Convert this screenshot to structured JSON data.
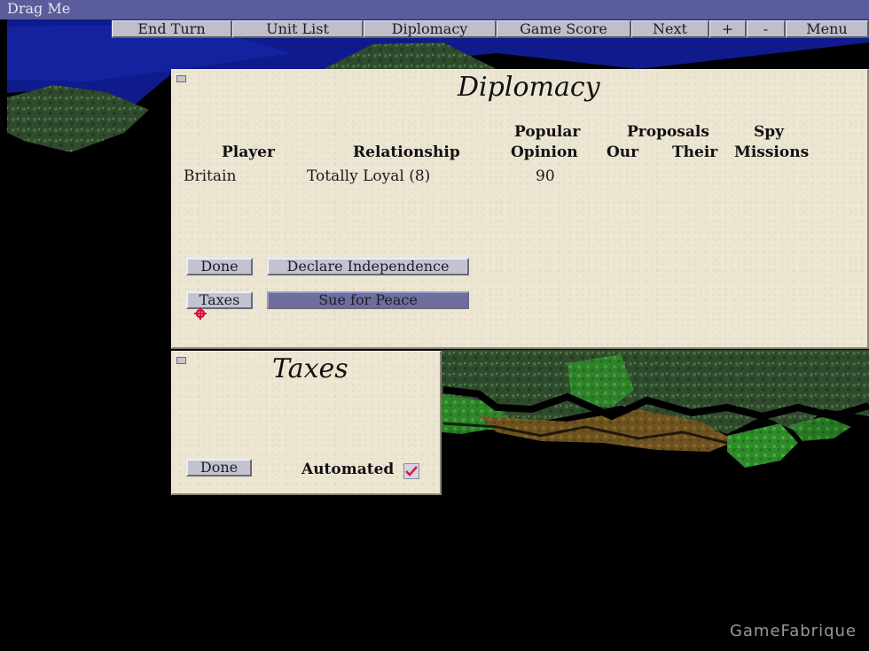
{
  "window": {
    "title": "Drag Me"
  },
  "menu": [
    {
      "id": "end-turn",
      "label": "End Turn"
    },
    {
      "id": "unit-list",
      "label": "Unit List"
    },
    {
      "id": "diplomacy",
      "label": "Diplomacy"
    },
    {
      "id": "game-score",
      "label": "Game Score"
    },
    {
      "id": "next",
      "label": "Next"
    },
    {
      "id": "plus",
      "label": "+"
    },
    {
      "id": "minus",
      "label": "-"
    },
    {
      "id": "menu",
      "label": "Menu"
    }
  ],
  "diplomacy": {
    "title": "Diplomacy",
    "headers": {
      "player": "Player",
      "relationship": "Relationship",
      "popular": "Popular",
      "opinion": "Opinion",
      "proposals": "Proposals",
      "our": "Our",
      "their": "Their",
      "spy": "Spy",
      "missions": "Missions"
    },
    "rows": [
      {
        "player": "Britain",
        "relationship": "Totally Loyal (8)",
        "opinion": "90",
        "our": "",
        "their": "",
        "spy_missions": ""
      }
    ],
    "buttons": {
      "done": "Done",
      "declare": "Declare Independence",
      "taxes": "Taxes",
      "sue": "Sue for Peace"
    }
  },
  "taxes": {
    "title": "Taxes",
    "done": "Done",
    "automated_label": "Automated",
    "automated_checked": true
  },
  "watermark": "GameFabrique",
  "colors": {
    "titlebar": "#5a5c9c",
    "parchment": "#ece6d3",
    "button": "#c3c3d0",
    "button_selected": "#6e6e9e",
    "checkmark": "#c8203a"
  }
}
